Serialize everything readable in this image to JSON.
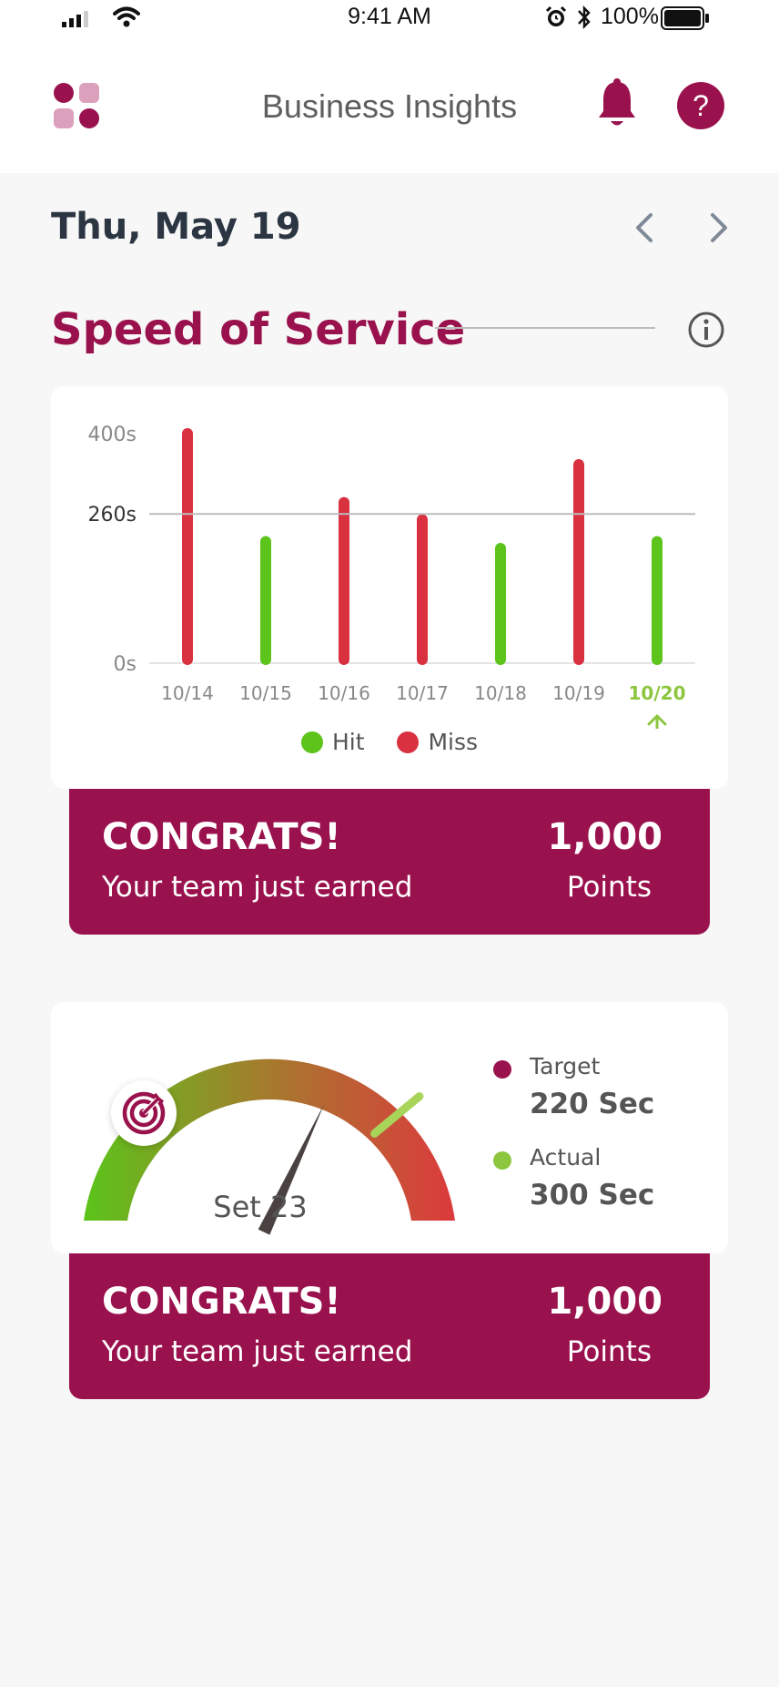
{
  "status_bar": {
    "time": "9:41 AM",
    "battery_percent": "100%",
    "icons": [
      "signal-icon",
      "wifi-icon",
      "alarm-icon",
      "bluetooth-icon",
      "battery-icon"
    ]
  },
  "header": {
    "title": "Business Insights",
    "icons": [
      "app-grid-icon",
      "bell-icon",
      "help-icon"
    ],
    "help_glyph": "?"
  },
  "date_nav": {
    "date": "Thu, May 19",
    "icons": [
      "chevron-left-icon",
      "chevron-right-icon"
    ]
  },
  "section": {
    "title": "Speed of Service",
    "icon": "info-icon"
  },
  "colors": {
    "brand": "#9a124d",
    "hit": "#5cc41a",
    "miss": "#d9313f",
    "target_line": "#cccccc"
  },
  "chart_data": {
    "type": "bar",
    "categories": [
      "10/14",
      "10/15",
      "10/16",
      "10/17",
      "10/18",
      "10/19",
      "10/20"
    ],
    "values": [
      400,
      212,
      280,
      250,
      200,
      346,
      212
    ],
    "status": [
      "Miss",
      "Hit",
      "Miss",
      "Miss",
      "Hit",
      "Miss",
      "Hit"
    ],
    "y_ticks": [
      "0s",
      "260s",
      "400s"
    ],
    "y_tick_values": [
      0,
      260,
      400
    ],
    "target_value": 260,
    "ylim": [
      0,
      400
    ],
    "highlighted_category": "10/20",
    "legend": [
      "Hit",
      "Miss"
    ],
    "legend_placement": "bottom",
    "grid": false
  },
  "congrats_cards": [
    {
      "heading": "CONGRATS!",
      "subtext": "Your team just earned",
      "points": "1,000",
      "unit": "Points"
    },
    {
      "heading": "CONGRATS!",
      "subtext": "Your team just earned",
      "points": "1,000",
      "unit": "Points"
    }
  ],
  "gauge": {
    "label": "Set 23",
    "target_label": "Target",
    "target_value": "220 Sec",
    "actual_label": "Actual",
    "actual_value": "300 Sec",
    "target_fraction": 0.64,
    "actual_fraction": 0.78,
    "badge_icon": "target-icon",
    "target_dot_color": "#9a124d",
    "actual_dot_color": "#8cc63f"
  }
}
